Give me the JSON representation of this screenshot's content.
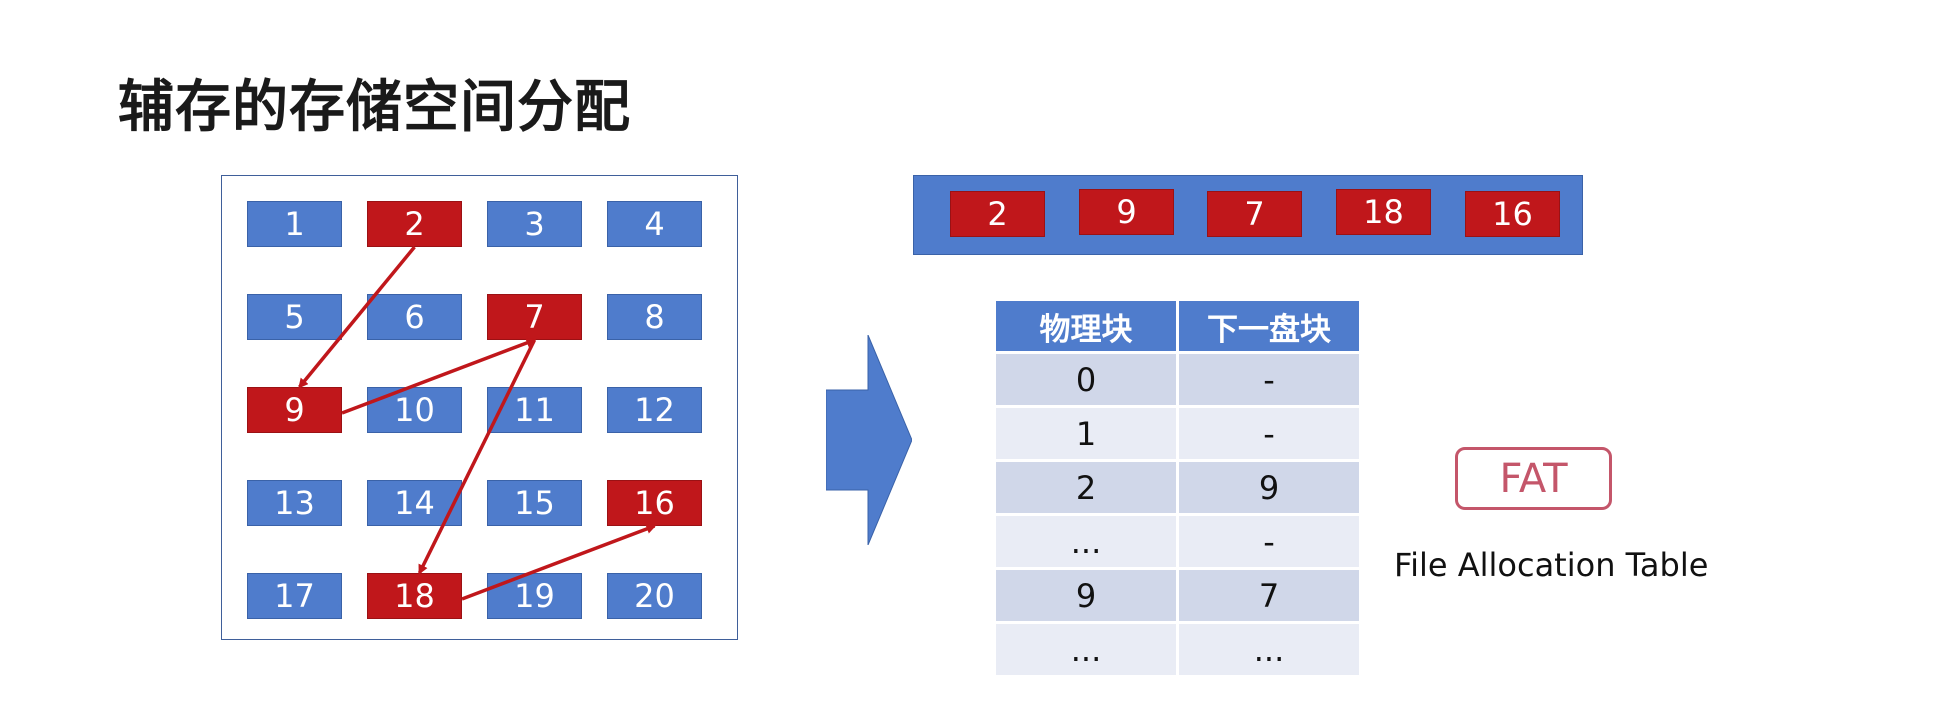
{
  "title": "辅存的存储空间分配",
  "colors": {
    "free_block": "#4f7ccc",
    "used_block": "#c0171b",
    "table_header": "#4f7ccc",
    "table_row_odd": "#d0d7e9",
    "table_row_even": "#e9ecf5",
    "fat_badge": "#c4566a",
    "arrow": "#c0171b"
  },
  "grid": {
    "blocks": [
      {
        "label": "1",
        "used": false
      },
      {
        "label": "2",
        "used": true
      },
      {
        "label": "3",
        "used": false
      },
      {
        "label": "4",
        "used": false
      },
      {
        "label": "5",
        "used": false
      },
      {
        "label": "6",
        "used": false
      },
      {
        "label": "7",
        "used": true
      },
      {
        "label": "8",
        "used": false
      },
      {
        "label": "9",
        "used": true
      },
      {
        "label": "10",
        "used": false
      },
      {
        "label": "11",
        "used": false
      },
      {
        "label": "12",
        "used": false
      },
      {
        "label": "13",
        "used": false
      },
      {
        "label": "14",
        "used": false
      },
      {
        "label": "15",
        "used": false
      },
      {
        "label": "16",
        "used": true
      },
      {
        "label": "17",
        "used": false
      },
      {
        "label": "18",
        "used": true
      },
      {
        "label": "19",
        "used": false
      },
      {
        "label": "20",
        "used": false
      }
    ],
    "chain": [
      "2",
      "9",
      "7",
      "18",
      "16"
    ]
  },
  "chain_bar": {
    "items": [
      "2",
      "9",
      "7",
      "18",
      "16"
    ]
  },
  "fat_table": {
    "headers": [
      "物理块",
      "下一盘块"
    ],
    "rows": [
      [
        "0",
        "-"
      ],
      [
        "1",
        "-"
      ],
      [
        "2",
        "9"
      ],
      [
        "...",
        "-"
      ],
      [
        "9",
        "7"
      ],
      [
        "...",
        "..."
      ]
    ]
  },
  "fat_label": "FAT",
  "fat_caption": "File Allocation Table"
}
